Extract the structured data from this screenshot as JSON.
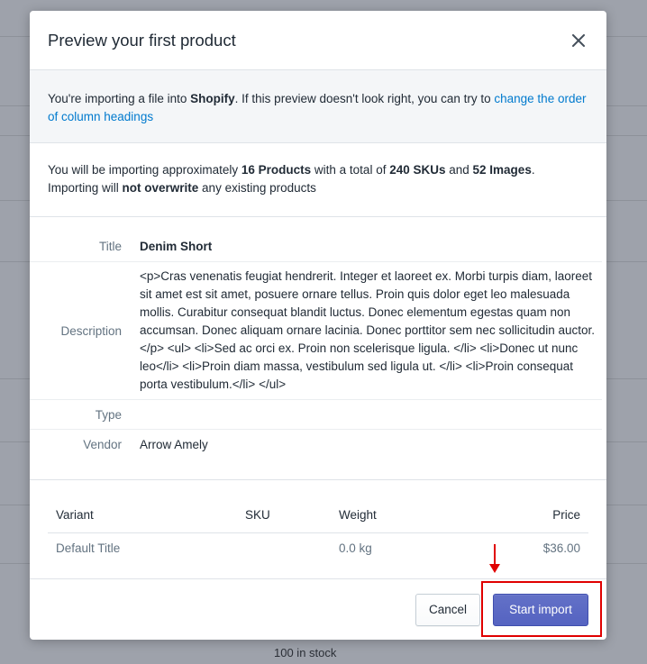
{
  "background": {
    "stock_text": "100 in stock"
  },
  "modal": {
    "title": "Preview your first product",
    "notice": {
      "prefix": "You're importing a file into ",
      "platform": "Shopify",
      "middle": ". If this preview doesn't look right, you can try to ",
      "link_text": "change the order of column headings"
    },
    "summary": {
      "t1": "You will be importing approximately ",
      "products": "16 Products",
      "t2": " with a total of ",
      "skus": "240 SKUs",
      "t3": " and ",
      "images": "52 Images",
      "t4": ".",
      "t5": "Importing will ",
      "not_overwrite": "not overwrite",
      "t6": " any existing products"
    },
    "details": {
      "title_label": "Title",
      "title_value": "Denim Short",
      "description_label": "Description",
      "description_value": "<p>Cras venenatis feugiat hendrerit. Integer et laoreet ex. Morbi turpis diam, laoreet sit amet est sit amet, posuere ornare tellus. Proin quis dolor eget leo malesuada mollis. Curabitur consequat blandit luctus. Donec elementum egestas quam non accumsan. Donec aliquam ornare lacinia. Donec porttitor sem nec sollicitudin auctor.</p> <ul> <li>Sed ac orci ex. Proin non scelerisque ligula. </li> <li>Donec ut nunc leo</li> <li>Proin diam massa, vestibulum sed ligula ut. </li> <li>Proin consequat porta vestibulum.</li> </ul>",
      "type_label": "Type",
      "type_value": "",
      "vendor_label": "Vendor",
      "vendor_value": "Arrow Amely"
    },
    "variants": {
      "headers": {
        "variant": "Variant",
        "sku": "SKU",
        "weight": "Weight",
        "price": "Price"
      },
      "rows": [
        {
          "variant": "Default Title",
          "sku": "",
          "weight": "0.0 kg",
          "price": "$36.00"
        }
      ]
    },
    "footer": {
      "cancel_label": "Cancel",
      "start_label": "Start import"
    }
  },
  "annotation": {
    "color": "#e00000"
  }
}
